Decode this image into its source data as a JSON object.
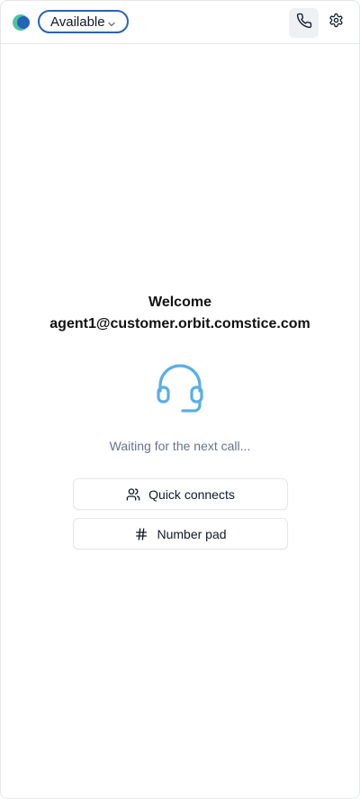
{
  "header": {
    "status": {
      "selected": "Available"
    },
    "icons": {
      "logo": "app-logo",
      "phone": "phone-icon",
      "settings": "gear-icon",
      "dropdown": "chevron-down-icon"
    },
    "colors": {
      "status_border": "#2563b8",
      "logo_green": "#4fc3a1",
      "logo_blue": "#2563b8"
    }
  },
  "main": {
    "welcome": "Welcome",
    "email": "agent1@customer.orbit.comstice.com",
    "status_message": "Waiting for the next call...",
    "headset_icon": "headset-icon",
    "headset_color": "#5aaee6",
    "actions": [
      {
        "label": "Quick connects",
        "icon": "users-icon"
      },
      {
        "label": "Number pad",
        "icon": "hash-icon"
      }
    ]
  }
}
